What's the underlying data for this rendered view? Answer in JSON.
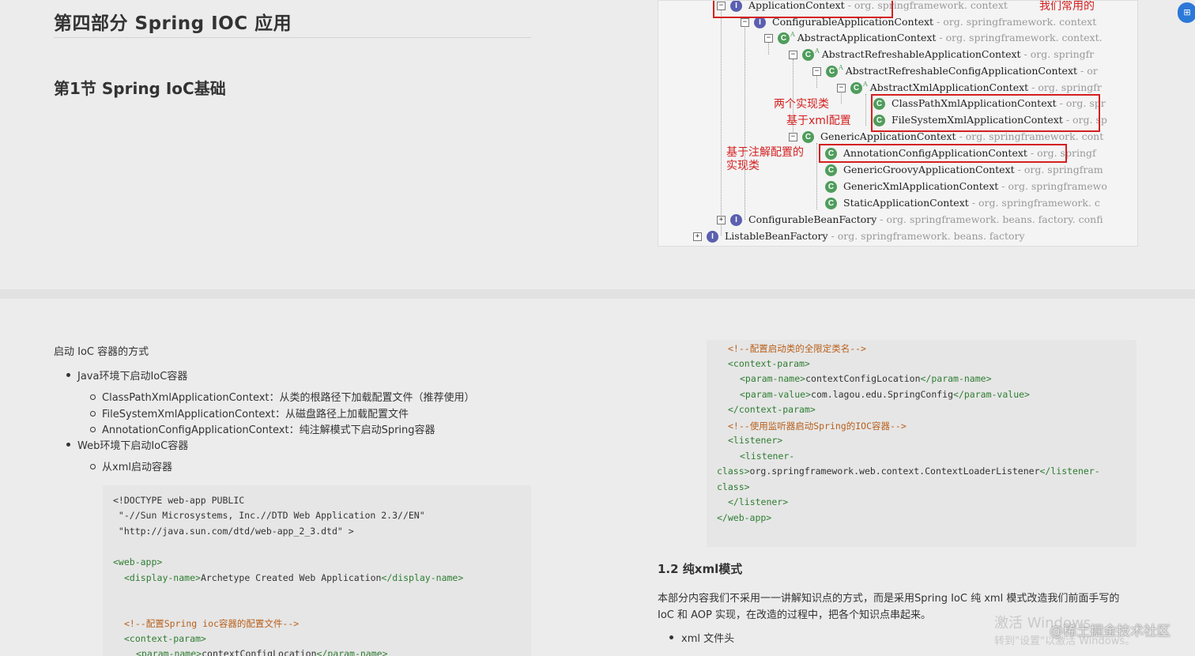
{
  "top": {
    "part_title": "第四部分 Spring IOC 应用",
    "section_title": "第1节 Spring IoC基础"
  },
  "tree": {
    "nodes": [
      {
        "name": "ApplicationContext",
        "pkg": "- org. springframework. context",
        "kind": "I"
      },
      {
        "name": "ConfigurableApplicationContext",
        "pkg": "- org. springframework. context",
        "kind": "I"
      },
      {
        "name": "AbstractApplicationContext",
        "pkg": "- org. springframework. context.",
        "kind": "C"
      },
      {
        "name": "AbstractRefreshableApplicationContext",
        "pkg": "- org. springfr",
        "kind": "C"
      },
      {
        "name": "AbstractRefreshableConfigApplicationContext",
        "pkg": "- or",
        "kind": "C"
      },
      {
        "name": "AbstractXmlApplicationContext",
        "pkg": "- org. springfr",
        "kind": "C"
      },
      {
        "name": "ClassPathXmlApplicationContext",
        "pkg": "- org. spr",
        "kind": "C"
      },
      {
        "name": "FileSystemXmlApplicationContext",
        "pkg": "- org. sp",
        "kind": "C"
      },
      {
        "name": "GenericApplicationContext",
        "pkg": "- org. springframework. cont",
        "kind": "C"
      },
      {
        "name": "AnnotationConfigApplicationContext",
        "pkg": "- org. springf",
        "kind": "C"
      },
      {
        "name": "GenericGroovyApplicationContext",
        "pkg": "- org. springfram",
        "kind": "C"
      },
      {
        "name": "GenericXmlApplicationContext",
        "pkg": "- org. springframewo",
        "kind": "C"
      },
      {
        "name": "StaticApplicationContext",
        "pkg": "- org. springframework. c",
        "kind": "C"
      },
      {
        "name": "ConfigurableBeanFactory",
        "pkg": "- org. springframework. beans. factory. confi",
        "kind": "I"
      },
      {
        "name": "ListableBeanFactory",
        "pkg": "- org. springframework. beans. factory",
        "kind": "I"
      }
    ],
    "notes": {
      "common": "我们常用的",
      "two_impl_line1": "两个实现类",
      "two_impl_line2": "基于xml配置",
      "anno_line1": "基于注解配置的",
      "anno_line2": "实现类"
    }
  },
  "bottom_left": {
    "intro": "启动 IoC 容器的方式",
    "java_env": "Java环境下启动IoC容器",
    "item_classpath": "ClassPathXmlApplicationContext：从类的根路径下加载配置文件（推荐使用）",
    "item_filesystem": "FileSystemXmlApplicationContext：从磁盘路径上加载配置文件",
    "item_annotation": "AnnotationConfigApplicationContext：纯注解模式下启动Spring容器",
    "web_env": "Web环境下启动IoC容器",
    "from_xml": "从xml启动容器",
    "code": {
      "l1": "<!DOCTYPE web-app PUBLIC",
      "l2": " \"-//Sun Microsystems, Inc.//DTD Web Application 2.3//EN\"",
      "l3": " \"http://java.sun.com/dtd/web-app_2_3.dtd\" >",
      "l4": "<web-app>",
      "l5_open": "<display-name>",
      "l5_text": "Archetype Created Web Application",
      "l5_close": "</display-name>",
      "l6": "<!--配置Spring ioc容器的配置文件-->",
      "l7": "<context-param>",
      "l8_open": "<param-name>",
      "l8_text": "contextConfigLocation",
      "l8_close": "</param-name>"
    }
  },
  "bottom_right": {
    "code": {
      "r1": "<!--配置启动类的全限定类名-->",
      "r2": "<context-param>",
      "r3_open": "<param-name>",
      "r3_text": "contextConfigLocation",
      "r3_close": "</param-name>",
      "r4_open": "<param-value>",
      "r4_text": "com.lagou.edu.SpringConfig",
      "r4_close": "</param-value>",
      "r5": "</context-param>",
      "r6": "<!--使用监听器启动Spring的IOC容器-->",
      "r7": "<listener>",
      "r8": "<listener-",
      "r9_open": "class>",
      "r9_text": "org.springframework.web.context.ContextLoaderListener",
      "r9_close": "</listener-",
      "r10": "class>",
      "r11": "</listener>",
      "r12": "</web-app>"
    },
    "heading": "1.2 纯xml模式",
    "desc_line1": "本部分内容我们不采用一一讲解知识点的方式，而是采用Spring IoC 纯 xml 模式改造我们前面手写的",
    "desc_line2": "IoC 和 AOP 实现，在改造的过程中，把各个知识点串起来。",
    "bullet_xml": "xml 文件头"
  },
  "watermark": {
    "activate": "激活 Windows",
    "activate_sub": "转到\"设置\"以激活 Windows。",
    "site": "@稀土掘金技术社区"
  },
  "colors": {
    "tag": "#2e7d32",
    "comment": "#b8601c",
    "annotation": "#d42020"
  }
}
